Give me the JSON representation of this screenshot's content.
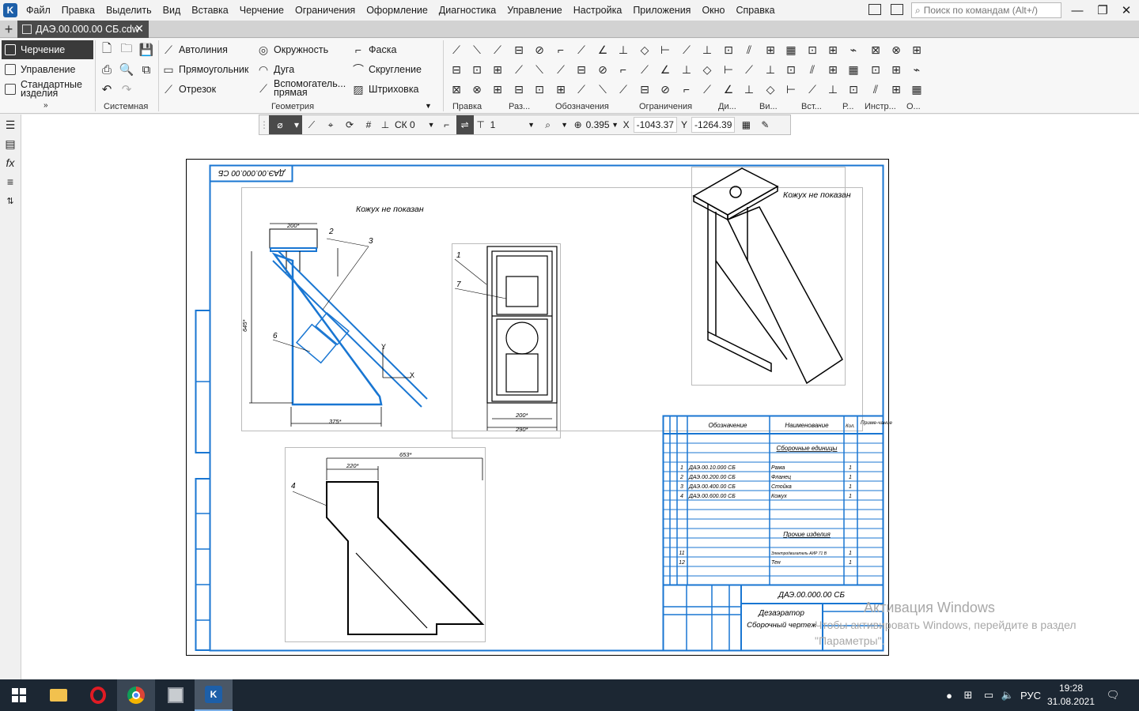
{
  "menu": {
    "items": [
      "Файл",
      "Правка",
      "Выделить",
      "Вид",
      "Вставка",
      "Черчение",
      "Ограничения",
      "Оформление",
      "Диагностика",
      "Управление",
      "Настройка",
      "Приложения",
      "Окно",
      "Справка"
    ],
    "search_placeholder": "Поиск по командам (Alt+/)"
  },
  "tab": {
    "label": "ДАЭ.00.000.00 СБ.cdw"
  },
  "ribbon": {
    "modes": [
      "Черчение",
      "Управление",
      "Стандартные изделия"
    ],
    "geometry_tools": {
      "autoline": "Автолиния",
      "rectangle": "Прямоугольник",
      "segment": "Отрезок",
      "circle": "Окружность",
      "arc": "Дуга",
      "aux_line": "Вспомогатель... прямая",
      "chamfer": "Фаска",
      "fillet": "Скругление",
      "hatch": "Штриховка"
    },
    "panels": [
      "Системная",
      "Геометрия",
      "Правка",
      "Раз...",
      "Обозначения",
      "Ограничения",
      "Ди...",
      "Ви...",
      "Вст...",
      "Р...",
      "Инстр...",
      "О..."
    ]
  },
  "float_toolbar": {
    "cs": "СК 0",
    "step": "1",
    "scale": "0.395",
    "x_label": "X",
    "x_value": "-1043.37",
    "y_label": "Y",
    "y_value": "-1264.39"
  },
  "drawing": {
    "doc_code_rotated": "ДАЭ.00.000.00 СБ",
    "note_left": "Кожух не показан",
    "note_right": "Кожух не показан",
    "table_headers": [
      "Обозначение",
      "Наименование",
      "Кол.",
      "Приме-чание"
    ],
    "section_assembly": "Сборочные единицы",
    "section_other": "Прочие изделия",
    "rows": [
      {
        "pos": "1",
        "code": "ДАЭ.00.10.000 СБ",
        "name": "Рама",
        "qty": "1"
      },
      {
        "pos": "2",
        "code": "ДАЭ.00.200.00 СБ",
        "name": "Фланец",
        "qty": "1"
      },
      {
        "pos": "3",
        "code": "ДАЭ.00.400.00 СБ",
        "name": "Стойка",
        "qty": "1"
      },
      {
        "pos": "4",
        "code": "ДАЭ.00.600.00 СБ",
        "name": "Кожух",
        "qty": "1"
      },
      {
        "pos": "11",
        "code": "",
        "name": "Электродвигатель АИР 71 В",
        "qty": "1"
      },
      {
        "pos": "12",
        "code": "",
        "name": "Тен",
        "qty": "1"
      }
    ],
    "title_code": "ДАЭ.00.000.00 СБ",
    "title_name_1": "Дезаэратор",
    "title_name_2": "Сборочный чертеж",
    "dims": {
      "d200a": "200*",
      "d375": "375*",
      "d645": "645*",
      "d200b": "200*",
      "d290": "290*",
      "d220": "220*",
      "d653": "653*"
    }
  },
  "watermark": {
    "line1": "Активация Windows",
    "line2": "Чтобы активировать Windows, перейдите в раздел",
    "line3": "\"Параметры\"."
  },
  "taskbar": {
    "lang": "РУС",
    "time": "19:28",
    "date": "31.08.2021"
  }
}
